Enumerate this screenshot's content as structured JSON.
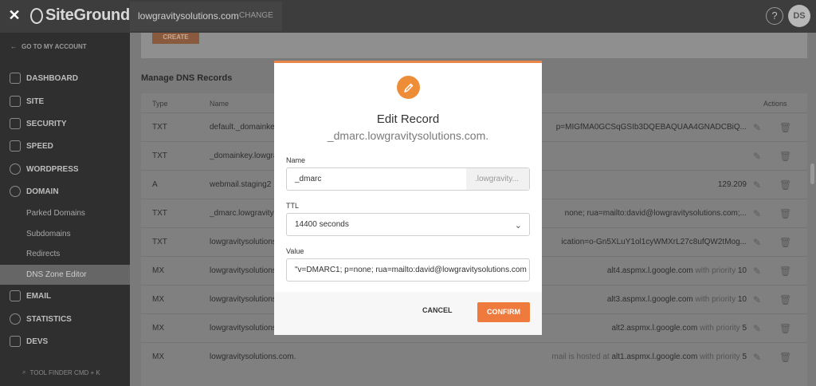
{
  "header": {
    "close_icon": "close-icon",
    "logo": "SiteGround",
    "site_name": "lowgravitysolutions.com",
    "change_label": "CHANGE",
    "help_label": "?",
    "avatar_initials": "DS"
  },
  "sidebar": {
    "back_label": "GO TO MY ACCOUNT",
    "items": [
      {
        "label": "DASHBOARD",
        "icon": "dashboard-icon"
      },
      {
        "label": "SITE",
        "icon": "site-icon"
      },
      {
        "label": "SECURITY",
        "icon": "lock-icon"
      },
      {
        "label": "SPEED",
        "icon": "rocket-icon"
      },
      {
        "label": "WORDPRESS",
        "icon": "wordpress-icon"
      },
      {
        "label": "DOMAIN",
        "icon": "globe-icon"
      }
    ],
    "sub_items": [
      "Parked Domains",
      "Subdomains",
      "Redirects",
      "DNS Zone Editor"
    ],
    "items_after": [
      {
        "label": "EMAIL",
        "icon": "mail-icon"
      },
      {
        "label": "STATISTICS",
        "icon": "chart-icon"
      },
      {
        "label": "DEVS",
        "icon": "code-icon"
      }
    ],
    "tool_finder": "TOOL FINDER CMD + K"
  },
  "main": {
    "create_label": "CREATE",
    "heading": "Manage DNS Records",
    "columns": {
      "type": "Type",
      "name": "Name",
      "actions": "Actions"
    },
    "rows": [
      {
        "type": "TXT",
        "name": "default._domainkey",
        "value_dim": "",
        "value": "p=MIGfMA0GCSqGSIb3DQEBAQUAA4GNADCBiQ..."
      },
      {
        "type": "TXT",
        "name": "_domainkey.lowgravity",
        "value_dim": "",
        "value": ""
      },
      {
        "type": "A",
        "name": "webmail.staging2",
        "value_dim": "",
        "value": "129.209"
      },
      {
        "type": "TXT",
        "name": "_dmarc.lowgravity",
        "value_dim": "",
        "value": "none; rua=mailto:david@lowgravitysolutions.com;..."
      },
      {
        "type": "TXT",
        "name": "lowgravitysolutions",
        "value_dim": "",
        "value": "ication=o-Gn5XLuY1ol1cyWMXrL27c8ufQW2tMog..."
      },
      {
        "type": "MX",
        "name": "lowgravitysolutions",
        "value_dim": "with priority",
        "value": "alt4.aspmx.l.google.com",
        "priority": "10"
      },
      {
        "type": "MX",
        "name": "lowgravitysolutions",
        "value_dim": "with priority",
        "value": "alt3.aspmx.l.google.com",
        "priority": "10"
      },
      {
        "type": "MX",
        "name": "lowgravitysolutions",
        "value_dim": "with priority",
        "value": "alt2.aspmx.l.google.com",
        "priority": "5"
      },
      {
        "type": "MX",
        "name": "lowgravitysolutions.com.",
        "value_dim": "mail is hosted at",
        "value": "alt1.aspmx.l.google.com",
        "priority": "5"
      }
    ]
  },
  "modal": {
    "icon": "pencil-icon",
    "title": "Edit Record",
    "subtitle": "_dmarc.lowgravitysolutions.com.",
    "name_label": "Name",
    "name_value": "_dmarc",
    "name_suffix": ".lowgravity...",
    "ttl_label": "TTL",
    "ttl_value": "14400 seconds",
    "value_label": "Value",
    "value_value": "\"v=DMARC1; p=none; rua=mailto:david@lowgravitysolutions.com",
    "cancel_label": "CANCEL",
    "confirm_label": "CONFIRM"
  },
  "colors": {
    "accent": "#ee7a3e",
    "topbar": "#3d3d3d",
    "sidebar": "#2f2f2f"
  }
}
